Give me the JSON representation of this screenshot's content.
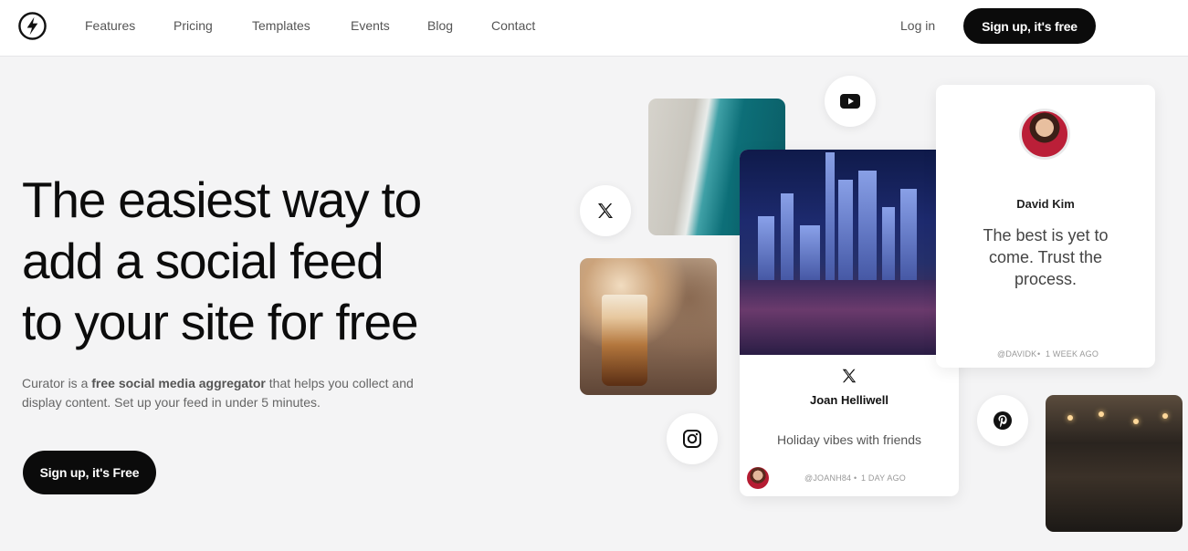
{
  "nav": {
    "logo_icon": "lightning-bolt-circle-icon",
    "links": [
      "Features",
      "Pricing",
      "Templates",
      "Events",
      "Blog",
      "Contact"
    ],
    "login": "Log in",
    "signup": "Sign up, it's free"
  },
  "hero": {
    "headline_lines": [
      "The easiest way to",
      "add a social feed",
      "to your site for free"
    ],
    "description_prefix": "Curator is a ",
    "description_bold": "free social media aggregator",
    "description_suffix": " that helps you collect and display content. Set up your feed in under 5 minutes.",
    "cta": "Sign up, it's Free"
  },
  "feed": {
    "icons": [
      "youtube-icon",
      "x-twitter-icon",
      "instagram-icon",
      "pinterest-icon"
    ],
    "joan_card": {
      "platform_icon": "x-twitter-icon",
      "name": "Joan Helliwell",
      "text": "Holiday vibes with friends",
      "handle": "@JOANH84",
      "time": "1 DAY AGO"
    },
    "david_card": {
      "name": "David Kim",
      "text": "The best is yet to come. Trust the process.",
      "handle": "@DAVIDK",
      "time": "1 WEEK AGO"
    }
  },
  "colors": {
    "background": "#f4f4f5",
    "button": "#0b0b0b",
    "text": "#111111"
  }
}
